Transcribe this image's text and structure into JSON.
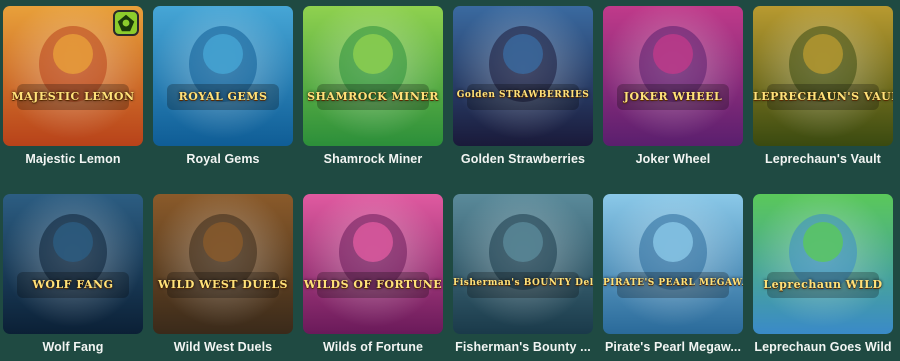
{
  "games": [
    {
      "title": "Majestic Lemon",
      "logo": "MAJESTIC LEMON",
      "icon": "lion-icon",
      "colors": [
        "#b8421a",
        "#e8a03a"
      ]
    },
    {
      "title": "Royal Gems",
      "logo": "ROYAL GEMS",
      "icon": "crown-icon",
      "colors": [
        "#0f5d96",
        "#46a6d6"
      ]
    },
    {
      "title": "Shamrock Miner",
      "logo": "SHAMROCK MINER",
      "icon": "leprechaun-icon",
      "colors": [
        "#2c8f3a",
        "#8fd14f"
      ]
    },
    {
      "title": "Golden Strawberries",
      "logo": "Golden STRAWBERRIES",
      "icon": "strawberry-icon",
      "colors": [
        "#1a1a3a",
        "#3a6aa0"
      ]
    },
    {
      "title": "Joker Wheel",
      "logo": "JOKER WHEEL",
      "icon": "wheel-icon",
      "colors": [
        "#5a1f6e",
        "#c03a8a"
      ]
    },
    {
      "title": "Leprechaun's Vault",
      "logo": "LEPRECHAUN'S VAULT",
      "icon": "leprechaun-icon",
      "colors": [
        "#3a4a10",
        "#b89a30"
      ]
    },
    {
      "title": "Wolf Fang",
      "logo": "WOLF FANG",
      "icon": "wolf-icon",
      "colors": [
        "#0b2036",
        "#2c5d82"
      ]
    },
    {
      "title": "Wild West Duels",
      "logo": "WILD WEST DUELS",
      "icon": "cowboy-icon",
      "colors": [
        "#3a2a1a",
        "#8a5a2a"
      ]
    },
    {
      "title": "Wilds of Fortune",
      "logo": "WILDS OF FORTUNE",
      "icon": "casino-icon",
      "colors": [
        "#6a1a5a",
        "#e05aa0"
      ]
    },
    {
      "title": "Fisherman's Bounty ...",
      "logo": "Fisherman's BOUNTY Deluxe",
      "icon": "fisherman-icon",
      "colors": [
        "#1a3a4a",
        "#5a8a9a"
      ]
    },
    {
      "title": "Pirate's Pearl Megaw...",
      "logo": "PIRATE'S PEARL MEGAWAYS",
      "icon": "pirate-icon",
      "colors": [
        "#2a6a9a",
        "#8ac8e8"
      ]
    },
    {
      "title": "Leprechaun Goes Wild",
      "logo": "Leprechaun WILD",
      "icon": "leprechaun-icon",
      "colors": [
        "#3a8ac8",
        "#5ac85a"
      ]
    }
  ],
  "badge": {
    "icon": "fruit-badge-icon",
    "color": "#8ccc2c"
  }
}
